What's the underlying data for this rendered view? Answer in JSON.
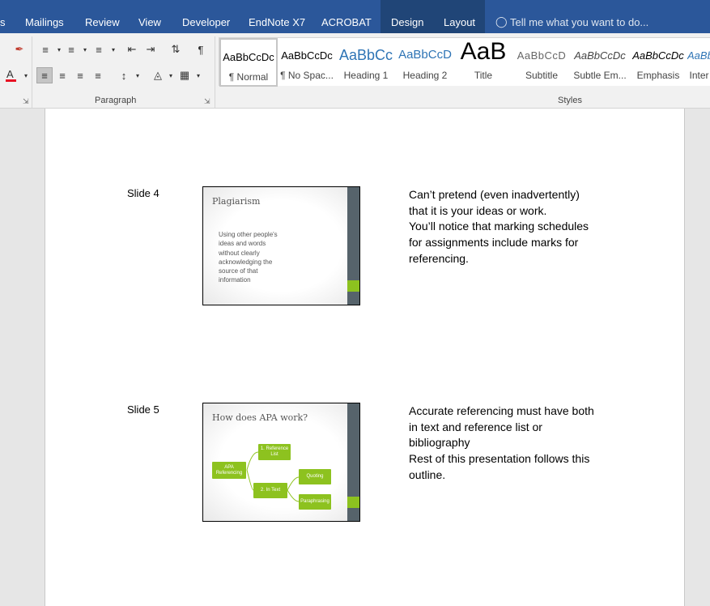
{
  "tabs": {
    "partial": "s",
    "mailings": "Mailings",
    "review": "Review",
    "view": "View",
    "developer": "Developer",
    "endnote": "EndNote X7",
    "acrobat": "ACROBAT",
    "design": "Design",
    "layout": "Layout",
    "tell_me": "Tell me what you want to do..."
  },
  "ribbon": {
    "paragraph_label": "Paragraph",
    "styles_label": "Styles",
    "colors": {
      "font_color": "#e81123",
      "ribbon_blue": "#2b579a"
    }
  },
  "styles": [
    {
      "sample": "AaBbCcDc",
      "name": "¶ Normal",
      "selected": true
    },
    {
      "sample": "AaBbCcDc",
      "name": "¶ No Spac..."
    },
    {
      "sample": "AaBbCc",
      "name": "Heading 1"
    },
    {
      "sample": "AaBbCcD",
      "name": "Heading 2"
    },
    {
      "sample": "AaB",
      "name": "Title"
    },
    {
      "sample": "AaBbCcD",
      "name": "Subtitle"
    },
    {
      "sample": "AaBbCcDc",
      "name": "Subtle Em..."
    },
    {
      "sample": "AaBbCcDc",
      "name": "Emphasis"
    },
    {
      "sample": "AaBb",
      "name": "Inter"
    }
  ],
  "document": {
    "slide4": {
      "label": "Slide 4",
      "title": "Plagiarism",
      "body": [
        "Using other people's",
        "ideas and words",
        "without clearly",
        "acknowledging the",
        "source of that",
        "information"
      ],
      "notes": [
        "Can’t pretend (even inadvertently)",
        "that it is your ideas or work.",
        "You’ll notice that marking schedules",
        "for assignments include marks for",
        "referencing."
      ]
    },
    "slide5": {
      "label": "Slide 5",
      "title": "How does APA work?",
      "diagram": {
        "root": "APA Referencing",
        "ref_list": "1. Reference List",
        "in_text": "2. In Text",
        "quoting": "Quoting",
        "paraphrasing": "Paraphrasing"
      },
      "notes": [
        "Accurate referencing must have both",
        "in text and reference list or",
        "bibliography",
        "Rest of this presentation follows this",
        "outline."
      ]
    }
  }
}
